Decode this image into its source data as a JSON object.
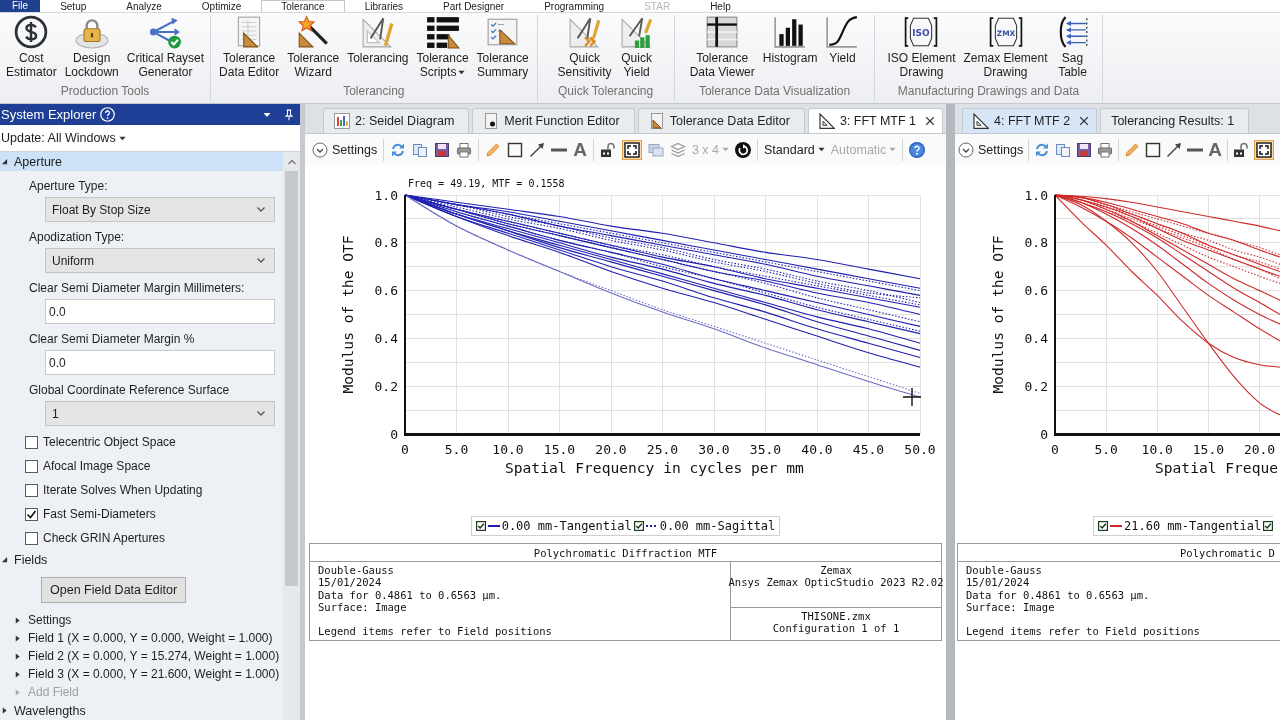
{
  "menu": {
    "file": "File",
    "tabs": [
      {
        "label": "Setup",
        "selected": false,
        "disabled": false
      },
      {
        "label": "Analyze",
        "selected": false,
        "disabled": false
      },
      {
        "label": "Optimize",
        "selected": false,
        "disabled": false
      },
      {
        "label": "Tolerance",
        "selected": true,
        "disabled": false
      },
      {
        "label": "Libraries",
        "selected": false,
        "disabled": false
      },
      {
        "label": "Part Designer",
        "selected": false,
        "disabled": false
      },
      {
        "label": "Programming",
        "selected": false,
        "disabled": false
      },
      {
        "label": "STAR",
        "selected": false,
        "disabled": true
      },
      {
        "label": "Help",
        "selected": false,
        "disabled": false
      }
    ]
  },
  "ribbon": [
    {
      "label": "Production Tools",
      "buttons": [
        {
          "label": "Cost\nEstimator",
          "has_menu": false
        },
        {
          "label": "Design\nLockdown",
          "has_menu": false
        },
        {
          "label": "Critical Rayset\nGenerator",
          "has_menu": false
        }
      ]
    },
    {
      "label": "Tolerancing",
      "buttons": [
        {
          "label": "Tolerance\nData Editor",
          "has_menu": false
        },
        {
          "label": "Tolerance\nWizard",
          "has_menu": false
        },
        {
          "label": "Tolerancing",
          "has_menu": false
        },
        {
          "label": "Tolerance\nScripts",
          "has_menu": true
        },
        {
          "label": "Tolerance\nSummary",
          "has_menu": false
        }
      ]
    },
    {
      "label": "Quick Tolerancing",
      "buttons": [
        {
          "label": "Quick\nSensitivity",
          "has_menu": false
        },
        {
          "label": "Quick\nYield",
          "has_menu": false
        }
      ]
    },
    {
      "label": "Tolerance Data Visualization",
      "buttons": [
        {
          "label": "Tolerance\nData Viewer",
          "has_menu": false
        },
        {
          "label": "Histogram",
          "has_menu": false
        },
        {
          "label": "Yield",
          "has_menu": false
        }
      ]
    },
    {
      "label": "Manufacturing Drawings and Data",
      "buttons": [
        {
          "label": "ISO Element\nDrawing",
          "has_menu": false,
          "icon_text": "ISO"
        },
        {
          "label": "Zemax Element\nDrawing",
          "has_menu": false,
          "icon_text": "ZMX"
        },
        {
          "label": "Sag\nTable",
          "has_menu": false
        }
      ]
    }
  ],
  "system_explorer": {
    "title": "System Explorer",
    "update": "Update: All Windows",
    "sections": [
      {
        "label": "Aperture",
        "expanded": true,
        "selected": true,
        "settings": [
          {
            "kind": "dropdown",
            "label": "Aperture Type:",
            "value": "Float By Stop Size"
          },
          {
            "kind": "dropdown",
            "label": "Apodization Type:",
            "value": "Uniform"
          },
          {
            "kind": "input",
            "label": "Clear Semi Diameter Margin Millimeters:",
            "value": "0.0"
          },
          {
            "kind": "input",
            "label": "Clear Semi Diameter Margin %",
            "value": "0.0"
          },
          {
            "kind": "dropdown",
            "label": "Global Coordinate Reference Surface",
            "value": "1"
          },
          {
            "kind": "checkbox",
            "label": "Telecentric Object Space",
            "checked": false
          },
          {
            "kind": "checkbox",
            "label": "Afocal Image Space",
            "checked": false
          },
          {
            "kind": "checkbox",
            "label": "Iterate Solves When Updating",
            "checked": false
          },
          {
            "kind": "checkbox",
            "label": "Fast Semi-Diameters",
            "checked": true
          },
          {
            "kind": "checkbox",
            "label": "Check GRIN Apertures",
            "checked": false
          }
        ]
      },
      {
        "label": "Fields",
        "expanded": true,
        "selected": false,
        "button": "Open Field Data Editor",
        "children": [
          {
            "label": "Settings",
            "expanded": false,
            "disabled": false
          },
          {
            "label": "Field 1 (X = 0.000, Y = 0.000, Weight = 1.000)",
            "expanded": false,
            "disabled": false
          },
          {
            "label": "Field 2 (X = 0.000, Y = 15.274, Weight = 1.000)",
            "expanded": false,
            "disabled": false
          },
          {
            "label": "Field 3 (X = 0.000, Y = 21.600, Weight = 1.000)",
            "expanded": false,
            "disabled": false
          },
          {
            "label": "Add Field",
            "expanded": false,
            "disabled": true
          }
        ]
      },
      {
        "label": "Wavelengths",
        "expanded": false,
        "selected": false
      }
    ]
  },
  "panels": [
    {
      "active": false,
      "tabs": [
        {
          "label": "2: Seidel Diagram",
          "selected": false
        },
        {
          "label": "Merit Function Editor",
          "selected": false
        },
        {
          "label": "Tolerance Data Editor",
          "selected": false
        },
        {
          "label": "3: FFT MTF 1",
          "selected": true
        }
      ],
      "toolbar": {
        "settings": "Settings",
        "text_tool": "A",
        "toggle": {
          "selected": true
        },
        "grid": {
          "label": "3 x 4",
          "disabled": true
        },
        "view": {
          "label": "Standard",
          "disabled": false
        },
        "scale": {
          "label": "Automatic",
          "disabled": true
        }
      },
      "chart_data": {
        "type": "line",
        "xlabel": "Spatial Frequency in cycles per mm",
        "ylabel": "Modulus of the OTF",
        "grid": true,
        "x": [
          0,
          5,
          10,
          15,
          20,
          25,
          30,
          35,
          40,
          45,
          50
        ],
        "xlim": [
          0,
          50
        ],
        "ylim": [
          0,
          1
        ],
        "xticks": [
          {
            "value": 0,
            "label": "0"
          },
          {
            "value": 5,
            "label": "5.0"
          },
          {
            "value": 10,
            "label": "10.0"
          },
          {
            "value": 15,
            "label": "15.0"
          },
          {
            "value": 20,
            "label": "20.0"
          },
          {
            "value": 25,
            "label": "25.0"
          },
          {
            "value": 30,
            "label": "30.0"
          },
          {
            "value": 35,
            "label": "35.0"
          },
          {
            "value": 40,
            "label": "40.0"
          },
          {
            "value": 45,
            "label": "45.0"
          },
          {
            "value": 50,
            "label": "50.0"
          }
        ],
        "yticks": [
          {
            "value": 0,
            "label": "0"
          },
          {
            "value": 0.2,
            "label": "0.2"
          },
          {
            "value": 0.4,
            "label": "0.4"
          },
          {
            "value": 0.6,
            "label": "0.6"
          },
          {
            "value": 0.8,
            "label": "0.8"
          },
          {
            "value": 1,
            "label": "1.0"
          }
        ],
        "series": [
          {
            "color": "#2020b0",
            "line_style": "solid",
            "values": [
              1,
              0.97,
              0.94,
              0.91,
              0.87,
              0.84,
              0.8,
              0.76,
              0.73,
              0.69,
              0.65
            ]
          },
          {
            "color": "#2020b0",
            "line_style": "solid",
            "values": [
              1,
              0.96,
              0.93,
              0.89,
              0.85,
              0.81,
              0.77,
              0.73,
              0.69,
              0.65,
              0.61
            ]
          },
          {
            "color": "#2020b0",
            "line_style": "solid",
            "values": [
              1,
              0.96,
              0.92,
              0.87,
              0.83,
              0.79,
              0.75,
              0.71,
              0.66,
              0.62,
              0.58
            ]
          },
          {
            "color": "#2020b0",
            "line_style": "solid",
            "values": [
              1,
              0.94,
              0.89,
              0.84,
              0.79,
              0.74,
              0.7,
              0.65,
              0.61,
              0.57,
              0.53
            ]
          },
          {
            "color": "#2020b0",
            "line_style": "solid",
            "values": [
              1,
              0.94,
              0.88,
              0.83,
              0.78,
              0.73,
              0.68,
              0.64,
              0.59,
              0.55,
              0.5
            ]
          },
          {
            "color": "#2020b0",
            "line_style": "solid",
            "values": [
              1,
              0.93,
              0.87,
              0.81,
              0.76,
              0.71,
              0.65,
              0.6,
              0.55,
              0.5,
              0.45
            ]
          },
          {
            "color": "#2020b0",
            "line_style": "solid",
            "values": [
              1,
              0.92,
              0.86,
              0.8,
              0.74,
              0.69,
              0.63,
              0.58,
              0.52,
              0.47,
              0.42
            ]
          },
          {
            "color": "#2020b0",
            "line_style": "solid",
            "values": [
              1,
              0.92,
              0.85,
              0.79,
              0.73,
              0.67,
              0.61,
              0.55,
              0.49,
              0.44,
              0.38
            ]
          },
          {
            "color": "#2020b0",
            "line_style": "solid",
            "values": [
              1,
              0.92,
              0.85,
              0.78,
              0.72,
              0.66,
              0.6,
              0.54,
              0.47,
              0.41,
              0.35
            ]
          },
          {
            "color": "#2020b0",
            "line_style": "solid",
            "values": [
              1,
              0.91,
              0.84,
              0.77,
              0.7,
              0.64,
              0.57,
              0.51,
              0.44,
              0.38,
              0.32
            ]
          },
          {
            "color": "#2020b0",
            "line_style": "solid",
            "values": [
              1,
              0.91,
              0.83,
              0.76,
              0.68,
              0.61,
              0.55,
              0.48,
              0.41,
              0.34,
              0.28
            ]
          },
          {
            "color": "#6c6cc6",
            "line_style": "solid",
            "values": [
              1,
              0.87,
              0.77,
              0.68,
              0.59,
              0.51,
              0.44,
              0.36,
              0.29,
              0.22,
              0.155
            ]
          },
          {
            "color": "#2020b0",
            "line_style": "dotted",
            "values": [
              1,
              0.96,
              0.92,
              0.88,
              0.84,
              0.8,
              0.76,
              0.72,
              0.68,
              0.64,
              0.6
            ]
          },
          {
            "color": "#2020b0",
            "line_style": "dotted",
            "values": [
              1,
              0.95,
              0.9,
              0.86,
              0.81,
              0.77,
              0.72,
              0.68,
              0.63,
              0.59,
              0.57
            ]
          },
          {
            "color": "#2020b0",
            "line_style": "dotted",
            "values": [
              1,
              0.96,
              0.91,
              0.87,
              0.82,
              0.78,
              0.73,
              0.69,
              0.64,
              0.6,
              0.55
            ]
          },
          {
            "color": "#2020b0",
            "line_style": "dotted",
            "values": [
              1,
              0.94,
              0.89,
              0.84,
              0.79,
              0.75,
              0.7,
              0.66,
              0.62,
              0.58,
              0.54
            ]
          },
          {
            "color": "#2020b0",
            "line_style": "dotted",
            "values": [
              1,
              0.94,
              0.88,
              0.83,
              0.78,
              0.73,
              0.68,
              0.63,
              0.57,
              0.52,
              0.47
            ]
          },
          {
            "color": "#2020b0",
            "line_style": "dotted",
            "values": [
              1,
              0.93,
              0.87,
              0.81,
              0.76,
              0.7,
              0.65,
              0.59,
              0.53,
              0.48,
              0.43
            ]
          },
          {
            "color": "#6c6cc6",
            "line_style": "dotted",
            "values": [
              1,
              0.87,
              0.77,
              0.68,
              0.6,
              0.52,
              0.45,
              0.38,
              0.31,
              0.24,
              0.17
            ]
          }
        ],
        "annotations": [
          "Freq = 49.19, MTF = 0.1558"
        ]
      },
      "legend": [
        {
          "label": "0.00 mm-Tangential",
          "checked": true,
          "dashed": false,
          "color": "#2020b0"
        },
        {
          "label": "0.00 mm-Sagittal",
          "checked": true,
          "dashed": true,
          "color": "#2020b0"
        }
      ],
      "info": {
        "title": "Polychromatic Diffraction MTF",
        "lines": [
          "Double-Gauss",
          "15/01/2024",
          "Data for 0.4861 to 0.6563 µm.",
          "Surface: Image"
        ],
        "note": "Legend items refer to Field positions",
        "vendor": [
          "Zemax",
          "Ansys Zemax OpticStudio 2023 R2.02"
        ],
        "file": [
          "THISONE.zmx",
          "Configuration 1 of 1"
        ]
      }
    },
    {
      "active": true,
      "tabs": [
        {
          "label": "4: FFT MTF 2",
          "selected": true
        },
        {
          "label": "Tolerancing Results: 1",
          "selected": false
        }
      ],
      "toolbar": {
        "settings": "Settings",
        "text_tool": "A",
        "toggle": {
          "selected": true
        }
      },
      "chart_data": {
        "type": "line",
        "xlabel": "Spatial Freque",
        "ylabel": "Modulus of the OTF",
        "grid": true,
        "x": [
          0,
          2.5,
          5,
          7.5,
          10,
          12.5,
          15,
          17.5,
          20,
          22
        ],
        "xlim": [
          0,
          22
        ],
        "ylim": [
          0,
          1
        ],
        "xticks": [
          {
            "value": 0,
            "label": "0"
          },
          {
            "value": 5,
            "label": "5.0"
          },
          {
            "value": 10,
            "label": "10.0"
          },
          {
            "value": 15,
            "label": "15.0"
          },
          {
            "value": 20,
            "label": "20.0"
          }
        ],
        "yticks": [
          {
            "value": 0,
            "label": "0"
          },
          {
            "value": 0.2,
            "label": "0.2"
          },
          {
            "value": 0.4,
            "label": "0.4"
          },
          {
            "value": 0.6,
            "label": "0.6"
          },
          {
            "value": 0.8,
            "label": "0.8"
          },
          {
            "value": 1,
            "label": "1.0"
          }
        ],
        "series": [
          {
            "color": "#cf2a2a",
            "line_style": "solid",
            "values": [
              1,
              0.89,
              0.79,
              0.68,
              0.58,
              0.47,
              0.38,
              0.32,
              0.29,
              0.28
            ]
          },
          {
            "color": "#cf2a2a",
            "line_style": "solid",
            "values": [
              1,
              0.96,
              0.89,
              0.8,
              0.68,
              0.53,
              0.38,
              0.24,
              0.13,
              0.08
            ]
          },
          {
            "color": "#cf2a2a",
            "line_style": "solid",
            "values": [
              1,
              0.95,
              0.89,
              0.82,
              0.74,
              0.66,
              0.58,
              0.51,
              0.44,
              0.39
            ]
          },
          {
            "color": "#cf2a2a",
            "line_style": "solid",
            "values": [
              1,
              0.97,
              0.92,
              0.86,
              0.79,
              0.71,
              0.63,
              0.56,
              0.5,
              0.46
            ]
          },
          {
            "color": "#cf2a2a",
            "line_style": "solid",
            "values": [
              1,
              0.97,
              0.93,
              0.88,
              0.82,
              0.75,
              0.68,
              0.61,
              0.55,
              0.5
            ]
          },
          {
            "color": "#cf2a2a",
            "line_style": "solid",
            "values": [
              1,
              0.98,
              0.94,
              0.89,
              0.83,
              0.77,
              0.71,
              0.65,
              0.6,
              0.56
            ]
          },
          {
            "color": "#cf2a2a",
            "line_style": "solid",
            "values": [
              1,
              0.98,
              0.95,
              0.91,
              0.86,
              0.81,
              0.77,
              0.73,
              0.69,
              0.66
            ]
          },
          {
            "color": "#cf2a2a",
            "line_style": "solid",
            "values": [
              1,
              0.99,
              0.96,
              0.92,
              0.88,
              0.84,
              0.79,
              0.75,
              0.71,
              0.68
            ]
          },
          {
            "color": "#cf2a2a",
            "line_style": "solid",
            "values": [
              1,
              0.99,
              0.97,
              0.94,
              0.91,
              0.88,
              0.84,
              0.81,
              0.77,
              0.74
            ]
          },
          {
            "color": "#cf2a2a",
            "line_style": "solid",
            "values": [
              1,
              0.995,
              0.985,
              0.97,
              0.95,
              0.93,
              0.91,
              0.89,
              0.87,
              0.85
            ]
          },
          {
            "color": "#cf2a2a",
            "line_style": "dotted",
            "values": [
              1,
              0.99,
              0.96,
              0.93,
              0.9,
              0.87,
              0.84,
              0.81,
              0.78,
              0.75
            ]
          },
          {
            "color": "#cf2a2a",
            "line_style": "dotted",
            "values": [
              1,
              0.98,
              0.95,
              0.92,
              0.88,
              0.84,
              0.81,
              0.77,
              0.74,
              0.71
            ]
          },
          {
            "color": "#cf2a2a",
            "line_style": "dotted",
            "values": [
              1,
              0.98,
              0.95,
              0.91,
              0.87,
              0.83,
              0.79,
              0.75,
              0.72,
              0.69
            ]
          },
          {
            "color": "#cf2a2a",
            "line_style": "dotted",
            "values": [
              1,
              0.98,
              0.94,
              0.9,
              0.86,
              0.82,
              0.78,
              0.73,
              0.69,
              0.65
            ]
          },
          {
            "color": "#cf2a2a",
            "line_style": "dotted",
            "values": [
              1,
              0.97,
              0.93,
              0.89,
              0.84,
              0.79,
              0.74,
              0.7,
              0.66,
              0.63
            ]
          }
        ]
      },
      "legend": [
        {
          "label": "21.60 mm-Tangential",
          "checked": true,
          "dashed": false,
          "color": "#cf2a2a"
        },
        {
          "checked": true
        }
      ],
      "info": {
        "title": "Polychromatic D",
        "lines": [
          "Double-Gauss",
          "15/01/2024",
          "Data for 0.4861 to 0.6563 µm.",
          "Surface: Image"
        ],
        "note": "Legend items refer to Field positions"
      }
    }
  ]
}
